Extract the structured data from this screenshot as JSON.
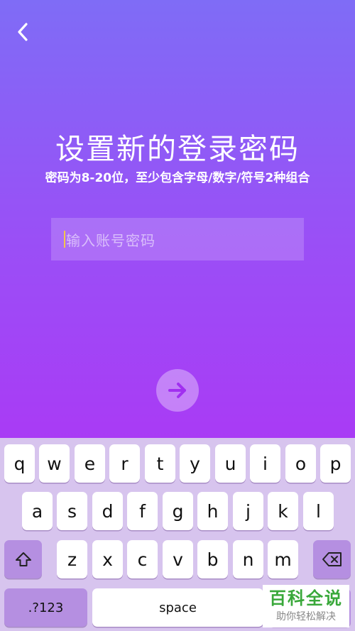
{
  "header": {
    "back_icon": "chevron-left-icon"
  },
  "main": {
    "title": "设置新的登录密码",
    "subtitle": "密码为8-20位，至少包含字母/数字/符号2种组合",
    "password_input": {
      "value": "",
      "placeholder": "输入账号密码"
    },
    "next_button_icon": "arrow-right-icon"
  },
  "keyboard": {
    "row1": [
      "q",
      "w",
      "e",
      "r",
      "t",
      "y",
      "u",
      "i",
      "o",
      "p"
    ],
    "row2": [
      "a",
      "s",
      "d",
      "f",
      "g",
      "h",
      "j",
      "k",
      "l"
    ],
    "row3": [
      "z",
      "x",
      "c",
      "v",
      "b",
      "n",
      "m"
    ],
    "shift_icon": "shift-icon",
    "delete_icon": "backspace-icon",
    "numbers_label": ".?123",
    "space_label": "space"
  },
  "watermark": {
    "brand": "百科全说",
    "slogan": "助你轻松解决"
  },
  "colors": {
    "gradient_top": "#7f6cf6",
    "gradient_bottom": "#a93bf5",
    "caret": "#f3c64a",
    "keyboard_bg": "#d7c4ee",
    "function_key": "#b58fe1",
    "brand_green": "#39a83a"
  }
}
